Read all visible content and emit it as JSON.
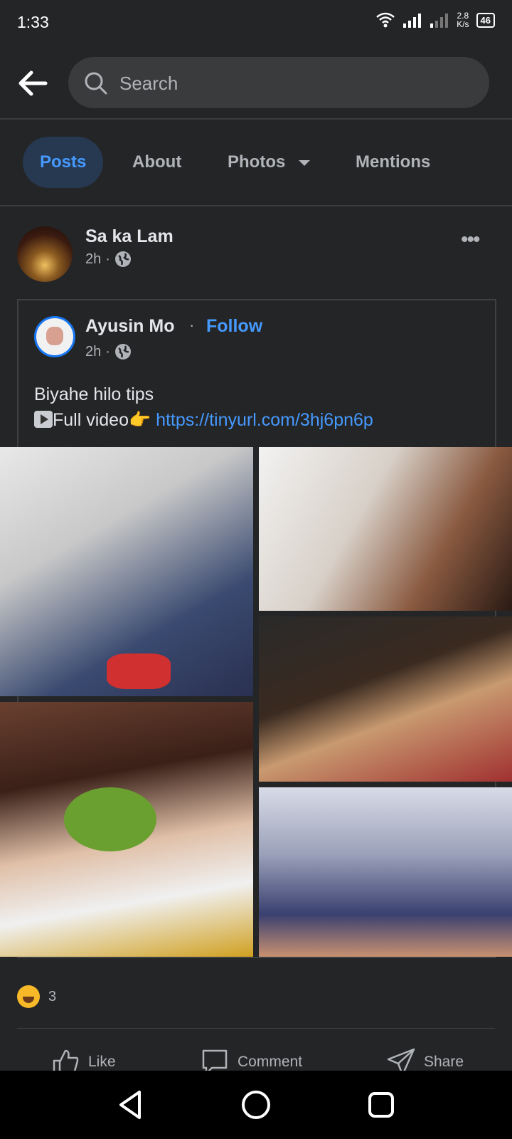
{
  "status": {
    "time": "1:33",
    "net_speed_top": "2.8",
    "net_speed_bottom": "K/s",
    "battery": "46"
  },
  "search": {
    "placeholder": "Search"
  },
  "tabs": [
    {
      "label": "Posts",
      "active": true
    },
    {
      "label": "About"
    },
    {
      "label": "Photos"
    },
    {
      "label": "Mentions"
    }
  ],
  "post": {
    "author": "Sa ka Lam",
    "time": "2h",
    "separator": "·",
    "shared": {
      "author": "Ayusin Mo",
      "dot": "·",
      "follow_label": "Follow",
      "time": "2h",
      "separator": "·",
      "text_line1": "Biyahe hilo tips",
      "text_line2": "Full video👉 ",
      "link": "https://tinyurl.com/3hj6pn6p"
    },
    "reaction_count": "3",
    "actions": {
      "like": "Like",
      "comment": "Comment",
      "share": "Share"
    }
  }
}
